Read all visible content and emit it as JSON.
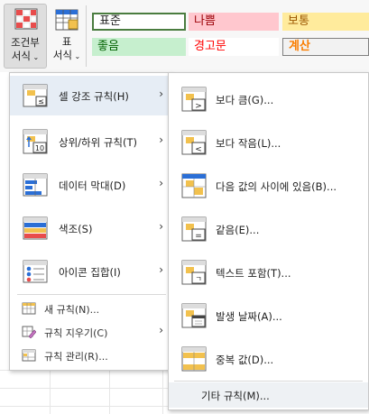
{
  "ribbon": {
    "conditional_format_label": [
      "조건부",
      "서식"
    ],
    "format_table_label": [
      "표",
      "서식"
    ],
    "styles": [
      {
        "label": "표준",
        "fill": "#ffffff",
        "color": "#1f1f1f",
        "border": "#4a7c3f"
      },
      {
        "label": "나쁨",
        "fill": "#ffc7ce",
        "color": "#9c0006"
      },
      {
        "label": "보통",
        "fill": "#ffeb9c",
        "color": "#9c5700"
      },
      {
        "label": "좋음",
        "fill": "#c6efce",
        "color": "#006100"
      },
      {
        "label": "경고문",
        "fill": "#ffffff",
        "color": "#ff0000"
      },
      {
        "label": "계산",
        "fill": "#f2f2f2",
        "color": "#fa7d00",
        "border": "#7f7f7f"
      }
    ]
  },
  "main_menu": {
    "items": [
      {
        "label": "셀 강조 규칙(H)",
        "icon": "highlight-cells-rules-icon",
        "highlighted": true
      },
      {
        "label": "상위/하위 규칙(T)",
        "icon": "top-bottom-rules-icon"
      },
      {
        "label": "데이터 막대(D)",
        "icon": "data-bars-icon"
      },
      {
        "label": "색조(S)",
        "icon": "color-scales-icon"
      },
      {
        "label": "아이콘 집합(I)",
        "icon": "icon-sets-icon"
      }
    ],
    "small_items": [
      {
        "label": "새 규칙(N)...",
        "icon": "new-rule-icon"
      },
      {
        "label": "규칙 지우기(C)",
        "icon": "clear-rules-icon",
        "submenu": true
      },
      {
        "label": "규칙 관리(R)...",
        "icon": "manage-rules-icon"
      }
    ],
    "chevron": "›"
  },
  "sub_menu": {
    "items": [
      {
        "label": "보다 큼(G)...",
        "icon": "greater-than-icon"
      },
      {
        "label": "보다 작음(L)...",
        "icon": "less-than-icon"
      },
      {
        "label": "다음 값의 사이에 있음(B)...",
        "icon": "between-icon"
      },
      {
        "label": "같음(E)...",
        "icon": "equal-to-icon"
      },
      {
        "label": "텍스트 포함(T)...",
        "icon": "text-contains-icon"
      },
      {
        "label": "발생 날짜(A)...",
        "icon": "date-occurring-icon"
      },
      {
        "label": "중복 값(D)...",
        "icon": "duplicate-values-icon"
      }
    ],
    "more_rules_label": "기타 규칙(M)..."
  },
  "colors": {
    "menu_highlight": "#e6edf5",
    "grid_line": "#e6e6e6",
    "icon_yellow": "#f2c14e",
    "icon_blue": "#2b6fd6",
    "icon_red": "#e84c4c"
  }
}
